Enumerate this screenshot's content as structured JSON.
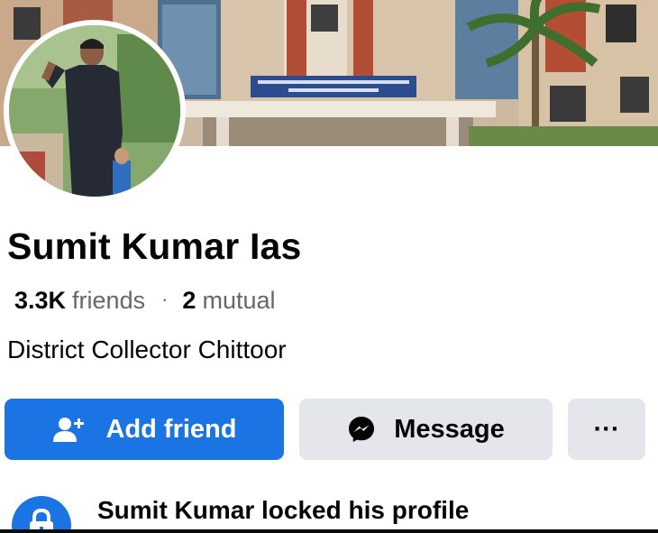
{
  "profile": {
    "name": "Sumit Kumar Ias",
    "friends_count": "3.3K",
    "friends_label": "friends",
    "separator": "·",
    "mutual_count": "2",
    "mutual_label": "mutual",
    "bio": "District Collector Chittoor"
  },
  "actions": {
    "add_friend_label": "Add friend",
    "add_friend_icon": "add-friend-icon",
    "message_label": "Message",
    "message_icon": "messenger-icon",
    "more_label": "···"
  },
  "notice": {
    "text": "Sumit Kumar locked his profile",
    "icon": "lock-icon"
  },
  "colors": {
    "primary": "#1b74e4",
    "secondary_button": "#e4e6eb",
    "muted_text": "#65676b"
  }
}
